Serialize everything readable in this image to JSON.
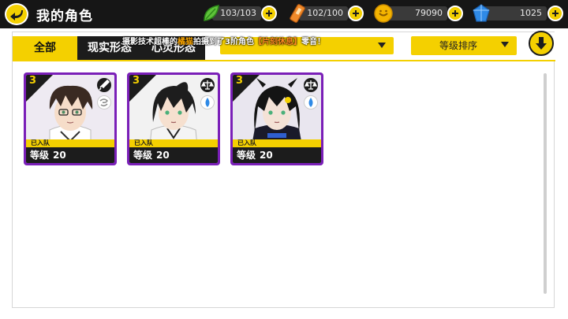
{
  "header": {
    "title": "我的角色",
    "back_icon": "back-arrow-icon"
  },
  "resources": [
    {
      "id": "stamina",
      "icon": "leaf-stamina-icon",
      "value": "103/103",
      "color": "#5fc33a"
    },
    {
      "id": "film",
      "icon": "film-roll-icon",
      "value": "102/100",
      "color": "#f08a2a"
    },
    {
      "id": "coins",
      "icon": "gold-coin-icon",
      "value": "79090",
      "color": "#f4b400"
    },
    {
      "id": "crystal",
      "icon": "blue-crystal-icon",
      "value": "1025",
      "color": "#2f8ae6"
    }
  ],
  "tabs": [
    {
      "label": "全部",
      "active": true
    },
    {
      "label": "现实形态",
      "active": false
    },
    {
      "label": "心灵形态",
      "active": false
    }
  ],
  "filter": {
    "value": ""
  },
  "sort": {
    "label": "等级排序"
  },
  "ticker": {
    "prefix": "摄影技术超棒的",
    "name": "橘猫",
    "middle": "拍摄到了3阶角色",
    "item": "【片刻休息】",
    "suffix": "零音！"
  },
  "characters": [
    {
      "tier": "3",
      "status": "已入队",
      "level_label": "等级",
      "level": "20",
      "attr_icon": "sword-icon",
      "element_icon": "wind-swirl-icon",
      "hair": "#3a2a22",
      "outfit": "#ffffff"
    },
    {
      "tier": "3",
      "status": "已入队",
      "level_label": "等级",
      "level": "20",
      "attr_icon": "scales-icon",
      "element_icon": "water-drop-icon",
      "hair": "#1d1d1d",
      "outfit": "#f4f4f4"
    },
    {
      "tier": "3",
      "status": "已入队",
      "level_label": "等级",
      "level": "20",
      "attr_icon": "scales-icon",
      "element_icon": "water-drop-icon",
      "hair": "#141414",
      "outfit": "#1a1a2a"
    }
  ],
  "colors": {
    "accent": "#f4d000",
    "card_frame": "#7a1fb8",
    "dark": "#1c1c1c"
  }
}
